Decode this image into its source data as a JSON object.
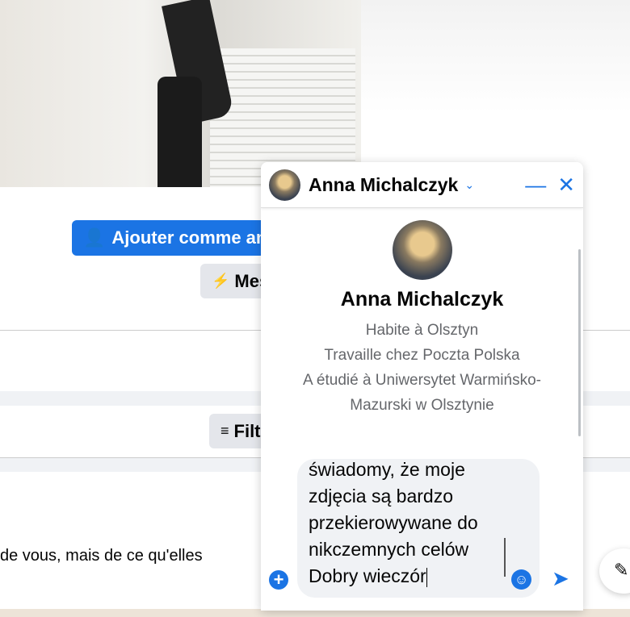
{
  "profile_page": {
    "add_friend_label": "Ajouter comme ami(e)",
    "message_label": "Message",
    "filter_label": "Filtres",
    "post_text": "de vous, mais de ce qu'elles"
  },
  "chat": {
    "header_name": "Anna Michalczyk",
    "profile_name": "Anna Michalczyk",
    "info": [
      "Habite à Olsztyn",
      "Travaille chez Poczta Polska",
      "A étudié à Uniwersytet Warmińsko-Mazurski w Olsztynie"
    ],
    "draft_lines": [
      "świadomy, że moje",
      "zdjęcia są bardzo",
      "przekierowywane do",
      "nikczemnych celów",
      "Dobry wieczór"
    ]
  },
  "colors": {
    "accent": "#1b74e4"
  }
}
